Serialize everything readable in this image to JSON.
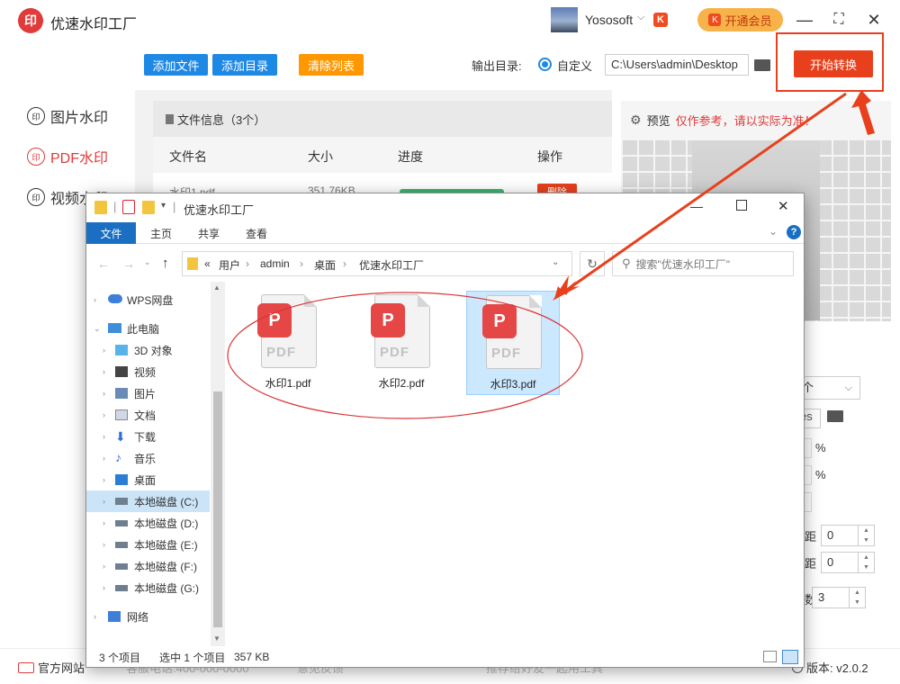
{
  "app": {
    "logo_text": "印",
    "title": "优速水印工厂",
    "username": "Yososoft",
    "user_badge": "K",
    "vip_label": "开通会员",
    "vip_icon": "K",
    "controls": {
      "minimize": "—",
      "maximize": "⛶",
      "close": "✕"
    }
  },
  "nav": {
    "items": [
      {
        "icon": "印",
        "label": "图片水印"
      },
      {
        "icon": "印",
        "label": "PDF水印"
      },
      {
        "icon": "印",
        "label": "视频水印"
      }
    ]
  },
  "toolbar": {
    "add_file": "添加文件",
    "add_dir": "添加目录",
    "clear_list": "清除列表",
    "output_label": "输出目录:",
    "radio_label": "自定义",
    "path_value": "C:\\Users\\admin\\Desktop",
    "start_label": "开始转换"
  },
  "file_table": {
    "info_label": "文件信息（3个）",
    "columns": [
      "文件名",
      "大小",
      "进度",
      "操作"
    ],
    "partial_row": {
      "name": "水印1.pdf",
      "size": "351.76KB",
      "action": "删除"
    }
  },
  "preview": {
    "label": "预览",
    "note": "仅作参考，请以实际为准！"
  },
  "settings": {
    "select_value": "个",
    "path_tail": "es",
    "pct1": "%",
    "pct2": "%",
    "spacing_label_1": "距",
    "spacing_value_1": "0",
    "spacing_label_2": "距",
    "spacing_value_2": "0",
    "count_label": "数",
    "count_value": "3"
  },
  "footer": {
    "website": "官方网站",
    "phone": "客服电话:400-000-0000",
    "feedback": "意见反馈",
    "share": "推荐给好友一起用工具",
    "version": "版本:  v2.0.2"
  },
  "explorer": {
    "title": "优速水印工厂",
    "ribbon_tabs": [
      "文件",
      "主页",
      "共享",
      "查看"
    ],
    "breadcrumb": [
      "用户",
      "admin",
      "桌面",
      "优速水印工厂"
    ],
    "breadcrumb_prefix": "«",
    "search_placeholder": "搜索\"优速水印工厂\"",
    "tree": [
      {
        "label": "WPS网盘",
        "icon": "cloud-icon"
      },
      {
        "label": "此电脑",
        "icon": "computer-icon"
      },
      {
        "label": "3D 对象",
        "icon": "3d-objects-icon"
      },
      {
        "label": "视频",
        "icon": "video-icon"
      },
      {
        "label": "图片",
        "icon": "pictures-icon"
      },
      {
        "label": "文档",
        "icon": "documents-icon"
      },
      {
        "label": "下载",
        "icon": "download-icon"
      },
      {
        "label": "音乐",
        "icon": "music-icon"
      },
      {
        "label": "桌面",
        "icon": "desktop-icon"
      },
      {
        "label": "本地磁盘 (C:)",
        "icon": "drive-icon"
      },
      {
        "label": "本地磁盘 (D:)",
        "icon": "drive-icon"
      },
      {
        "label": "本地磁盘 (E:)",
        "icon": "drive-icon"
      },
      {
        "label": "本地磁盘 (F:)",
        "icon": "drive-icon"
      },
      {
        "label": "本地磁盘 (G:)",
        "icon": "drive-icon"
      },
      {
        "label": "网络",
        "icon": "network-icon"
      }
    ],
    "files": [
      {
        "name": "水印1.pdf",
        "badge": "P",
        "type": "PDF"
      },
      {
        "name": "水印2.pdf",
        "badge": "P",
        "type": "PDF"
      },
      {
        "name": "水印3.pdf",
        "badge": "P",
        "type": "PDF"
      }
    ],
    "status": {
      "count": "3 个项目",
      "selected": "选中 1 个项目",
      "size": "357 KB"
    }
  },
  "colors": {
    "accent_red": "#e8401c",
    "blue": "#1e88e5",
    "orange": "#ff9800"
  }
}
